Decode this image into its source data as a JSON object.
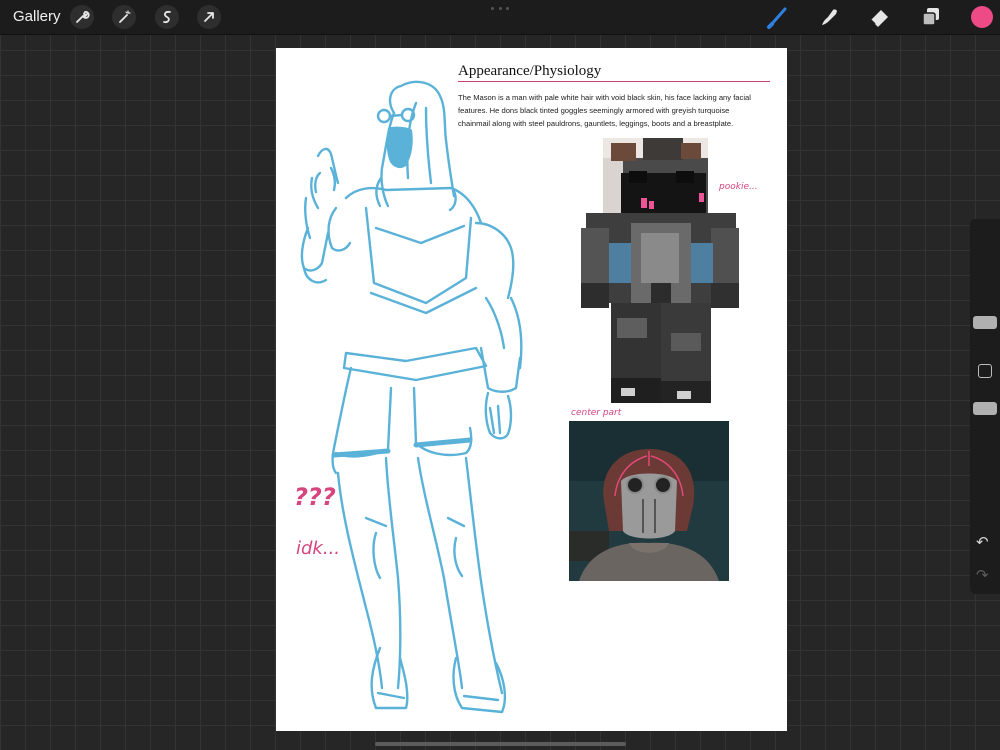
{
  "topbar": {
    "gallery_label": "Gallery",
    "left_tools": [
      "wrench-icon",
      "magic-wand-icon",
      "selection-icon",
      "transform-arrow-icon"
    ],
    "right_tools": [
      "brush-icon",
      "smudge-icon",
      "eraser-icon",
      "layers-icon"
    ],
    "active_color": "#ed4a86",
    "active_tool_color": "#2f7fe0"
  },
  "document": {
    "title": "Appearance/Physiology",
    "body": "The Mason is a man with pale white hair with void black skin, his face lacking any facial features. He dons black tinted goggles seemingly armored with greyish turquoise chainmail along with steel pauldrons, gauntlets, leggings, boots and a breastplate.",
    "accent_color": "#c2436c",
    "sketch_color": "#5ab2d8"
  },
  "annotations": {
    "question": "???",
    "idk": "idk...",
    "skin_note": "pookie...",
    "center_part": "center part",
    "ink_color": "#d6457f"
  },
  "sidebar": {
    "modify_icon": "modify-square-icon",
    "undo_icon": "undo-icon",
    "redo_icon": "redo-icon"
  }
}
